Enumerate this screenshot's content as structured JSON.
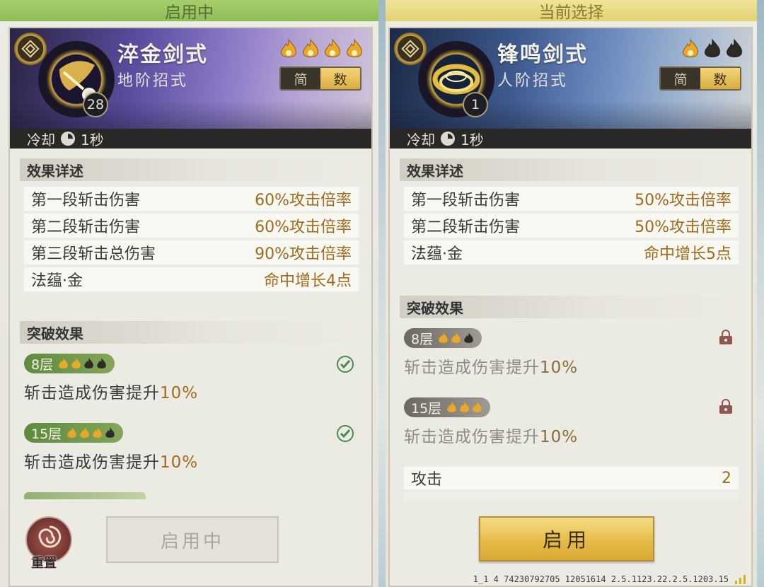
{
  "left": {
    "header": "启用中",
    "skill_name": "淬金剑式",
    "skill_tier": "地阶招式",
    "level": "28",
    "flames_filled": 4,
    "flames_total": 4,
    "toggle": {
      "simple": "简",
      "numeric": "数"
    },
    "cooldown_label": "冷却",
    "cooldown_value": "1秒",
    "effect_title": "效果详述",
    "effects": [
      {
        "name": "第一段斩击伤害",
        "value": "60%攻击倍率"
      },
      {
        "name": "第二段斩击伤害",
        "value": "60%攻击倍率"
      },
      {
        "name": "第三段斩击总伤害",
        "value": "90%攻击倍率"
      },
      {
        "name": "法蕴·金",
        "value": "命中增长4点"
      }
    ],
    "breakthrough_title": "突破效果",
    "breakthroughs": [
      {
        "tier": "8层",
        "flames": [
          1,
          1,
          0,
          0
        ],
        "desc": "斩击造成伤害提升",
        "pct": "10%"
      },
      {
        "tier": "15层",
        "flames": [
          1,
          1,
          1,
          0
        ],
        "desc": "斩击造成伤害提升",
        "pct": "10%"
      }
    ],
    "reset_label": "重置",
    "action_button": "启用中"
  },
  "right": {
    "header": "当前选择",
    "skill_name": "锋鸣剑式",
    "skill_tier": "人阶招式",
    "level": "1",
    "flames_filled": 1,
    "flames_total": 3,
    "toggle": {
      "simple": "简",
      "numeric": "数"
    },
    "cooldown_label": "冷却",
    "cooldown_value": "1秒",
    "effect_title": "效果详述",
    "effects": [
      {
        "name": "第一段斩击伤害",
        "value": "50%攻击倍率"
      },
      {
        "name": "第二段斩击伤害",
        "value": "50%攻击倍率"
      },
      {
        "name": "法蕴·金",
        "value": "命中增长5点"
      }
    ],
    "breakthrough_title": "突破效果",
    "breakthroughs": [
      {
        "tier": "8层",
        "flames": [
          1,
          1,
          0
        ],
        "desc": "斩击造成伤害提升",
        "pct": "10%"
      },
      {
        "tier": "15层",
        "flames": [
          1,
          1,
          1
        ],
        "desc": "斩击造成伤害提升",
        "pct": "10%"
      }
    ],
    "attack_label": "攻击",
    "attack_value": "2",
    "action_button": "启用"
  },
  "footer_debug": "1_1 4 74230792705 12051614 2.5.1123.22.2.5.1203.15",
  "colors": {
    "flame_lit": "#e9a82a",
    "flame_unlit": "#2e2a26",
    "value_orange": "#a06a1e",
    "check_green": "#4b8a4b"
  }
}
